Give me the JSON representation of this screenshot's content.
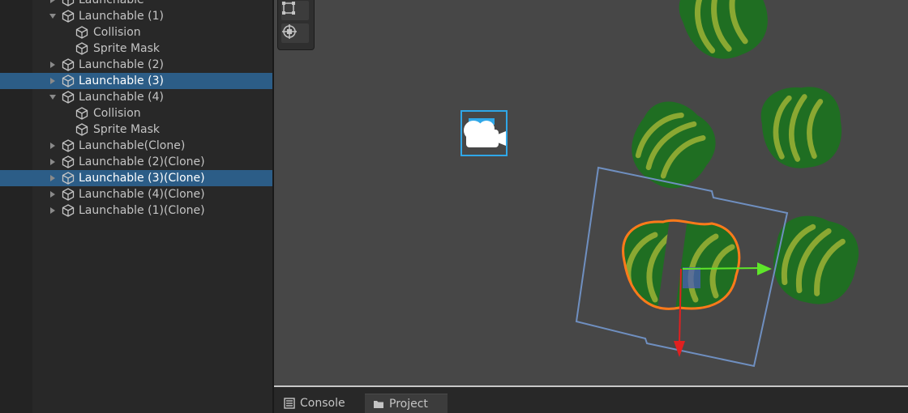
{
  "hierarchy": {
    "items": [
      {
        "label": "Launchable",
        "indent": 0,
        "expander": "collapsed",
        "selected": false
      },
      {
        "label": "Launchable (1)",
        "indent": 0,
        "expander": "expanded",
        "selected": false
      },
      {
        "label": "Collision",
        "indent": 1,
        "expander": "none",
        "selected": false
      },
      {
        "label": "Sprite Mask",
        "indent": 1,
        "expander": "none",
        "selected": false
      },
      {
        "label": "Launchable (2)",
        "indent": 0,
        "expander": "collapsed",
        "selected": false
      },
      {
        "label": "Launchable (3)",
        "indent": 0,
        "expander": "collapsed",
        "selected": true
      },
      {
        "label": "Launchable (4)",
        "indent": 0,
        "expander": "expanded",
        "selected": false
      },
      {
        "label": "Collision",
        "indent": 1,
        "expander": "none",
        "selected": false
      },
      {
        "label": "Sprite Mask",
        "indent": 1,
        "expander": "none",
        "selected": false
      },
      {
        "label": "Launchable(Clone)",
        "indent": 0,
        "expander": "collapsed",
        "selected": false
      },
      {
        "label": "Launchable (2)(Clone)",
        "indent": 0,
        "expander": "collapsed",
        "selected": false
      },
      {
        "label": "Launchable (3)(Clone)",
        "indent": 0,
        "expander": "collapsed",
        "selected": true
      },
      {
        "label": "Launchable (4)(Clone)",
        "indent": 0,
        "expander": "collapsed",
        "selected": false
      },
      {
        "label": "Launchable (1)(Clone)",
        "indent": 0,
        "expander": "collapsed",
        "selected": false
      }
    ]
  },
  "scene": {
    "tools": [
      "rect-tool-icon",
      "transform-tool-icon"
    ],
    "colors": {
      "background": "#474747",
      "leaf_dark": "#1f6e22",
      "leaf_stripe": "#8aa832",
      "selection_outline": "#ff7a1a",
      "mask_rect": "#6f8fc0",
      "x_axis": "#5ee62a",
      "y_axis": "#e02020",
      "camera_frame": "#2fa7e8"
    }
  },
  "bottom_tabs": [
    {
      "label": "Console",
      "icon": "console-icon",
      "active": false
    },
    {
      "label": "Project",
      "icon": "folder-icon",
      "active": true
    }
  ]
}
